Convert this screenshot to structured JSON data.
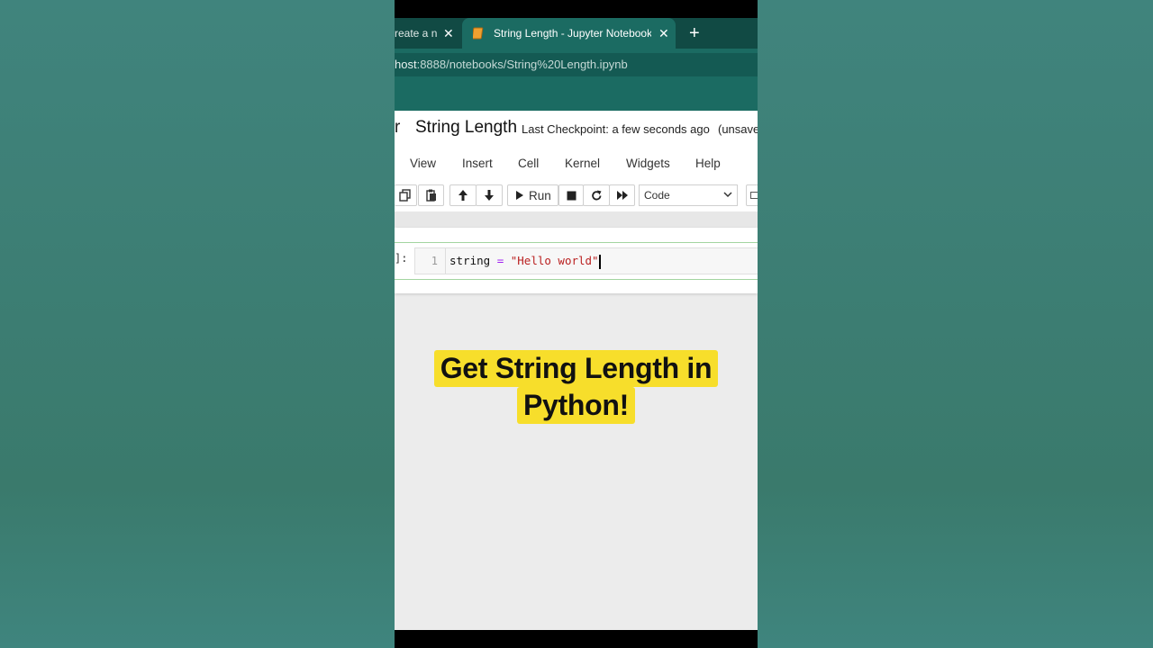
{
  "browser": {
    "inactive_tab_title": "reate a n",
    "active_tab_title": "String Length - Jupyter Notebook",
    "new_tab_label": "+",
    "close_label": "✕",
    "url_host": "host",
    "url_path": ":8888/notebooks/String%20Length.ipynb"
  },
  "notebook": {
    "logo_fragment": "r",
    "title": "String Length",
    "checkpoint": "Last Checkpoint: a few seconds ago",
    "unsaved": "(unsave"
  },
  "menu": {
    "items": [
      "View",
      "Insert",
      "Cell",
      "Kernel",
      "Widgets",
      "Help"
    ]
  },
  "toolbar": {
    "run_label": "Run",
    "cell_type": "Code"
  },
  "cell": {
    "prompt": "]:",
    "line_number": "1",
    "code_var": "string",
    "code_op": "=",
    "code_str": "\"Hello world\""
  },
  "caption": {
    "line1": "Get String Length in",
    "line2": "Python!"
  },
  "colors": {
    "tab_strip": "#114a44",
    "toolbar_teal": "#1b6b62",
    "caption_highlight": "#f7de2b"
  }
}
